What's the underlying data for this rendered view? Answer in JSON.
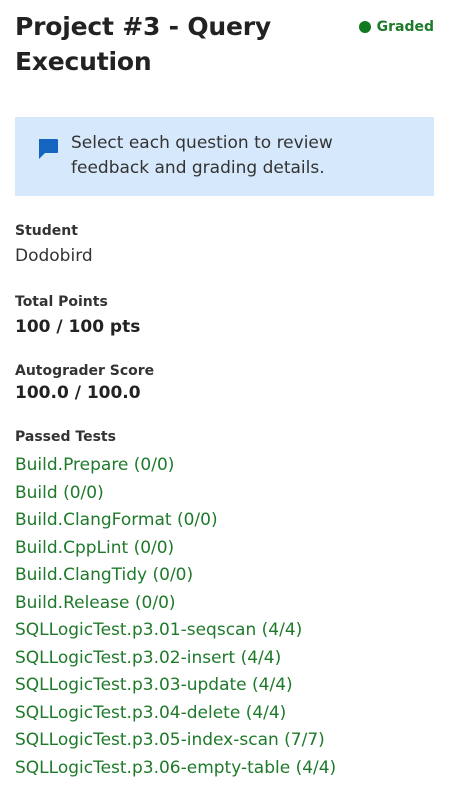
{
  "header": {
    "title": "Project #3 - Query Execution",
    "status": "Graded",
    "status_color": "#0f7a1f"
  },
  "notice": {
    "icon": "chat-bubble-icon",
    "text": "Select each question to review feedback and grading details."
  },
  "student": {
    "label": "Student",
    "value": "Dodobird"
  },
  "total_points": {
    "label": "Total Points",
    "value": "100 / 100 pts"
  },
  "autograder": {
    "label": "Autograder Score",
    "value": "100.0 / 100.0"
  },
  "passed_tests": {
    "label": "Passed Tests",
    "items": [
      "Build.Prepare (0/0)",
      "Build (0/0)",
      "Build.ClangFormat (0/0)",
      "Build.CppLint (0/0)",
      "Build.ClangTidy (0/0)",
      "Build.Release (0/0)",
      "SQLLogicTest.p3.01-seqscan (4/4)",
      "SQLLogicTest.p3.02-insert (4/4)",
      "SQLLogicTest.p3.03-update (4/4)",
      "SQLLogicTest.p3.04-delete (4/4)",
      "SQLLogicTest.p3.05-index-scan (7/7)",
      "SQLLogicTest.p3.06-empty-table (4/4)"
    ]
  }
}
